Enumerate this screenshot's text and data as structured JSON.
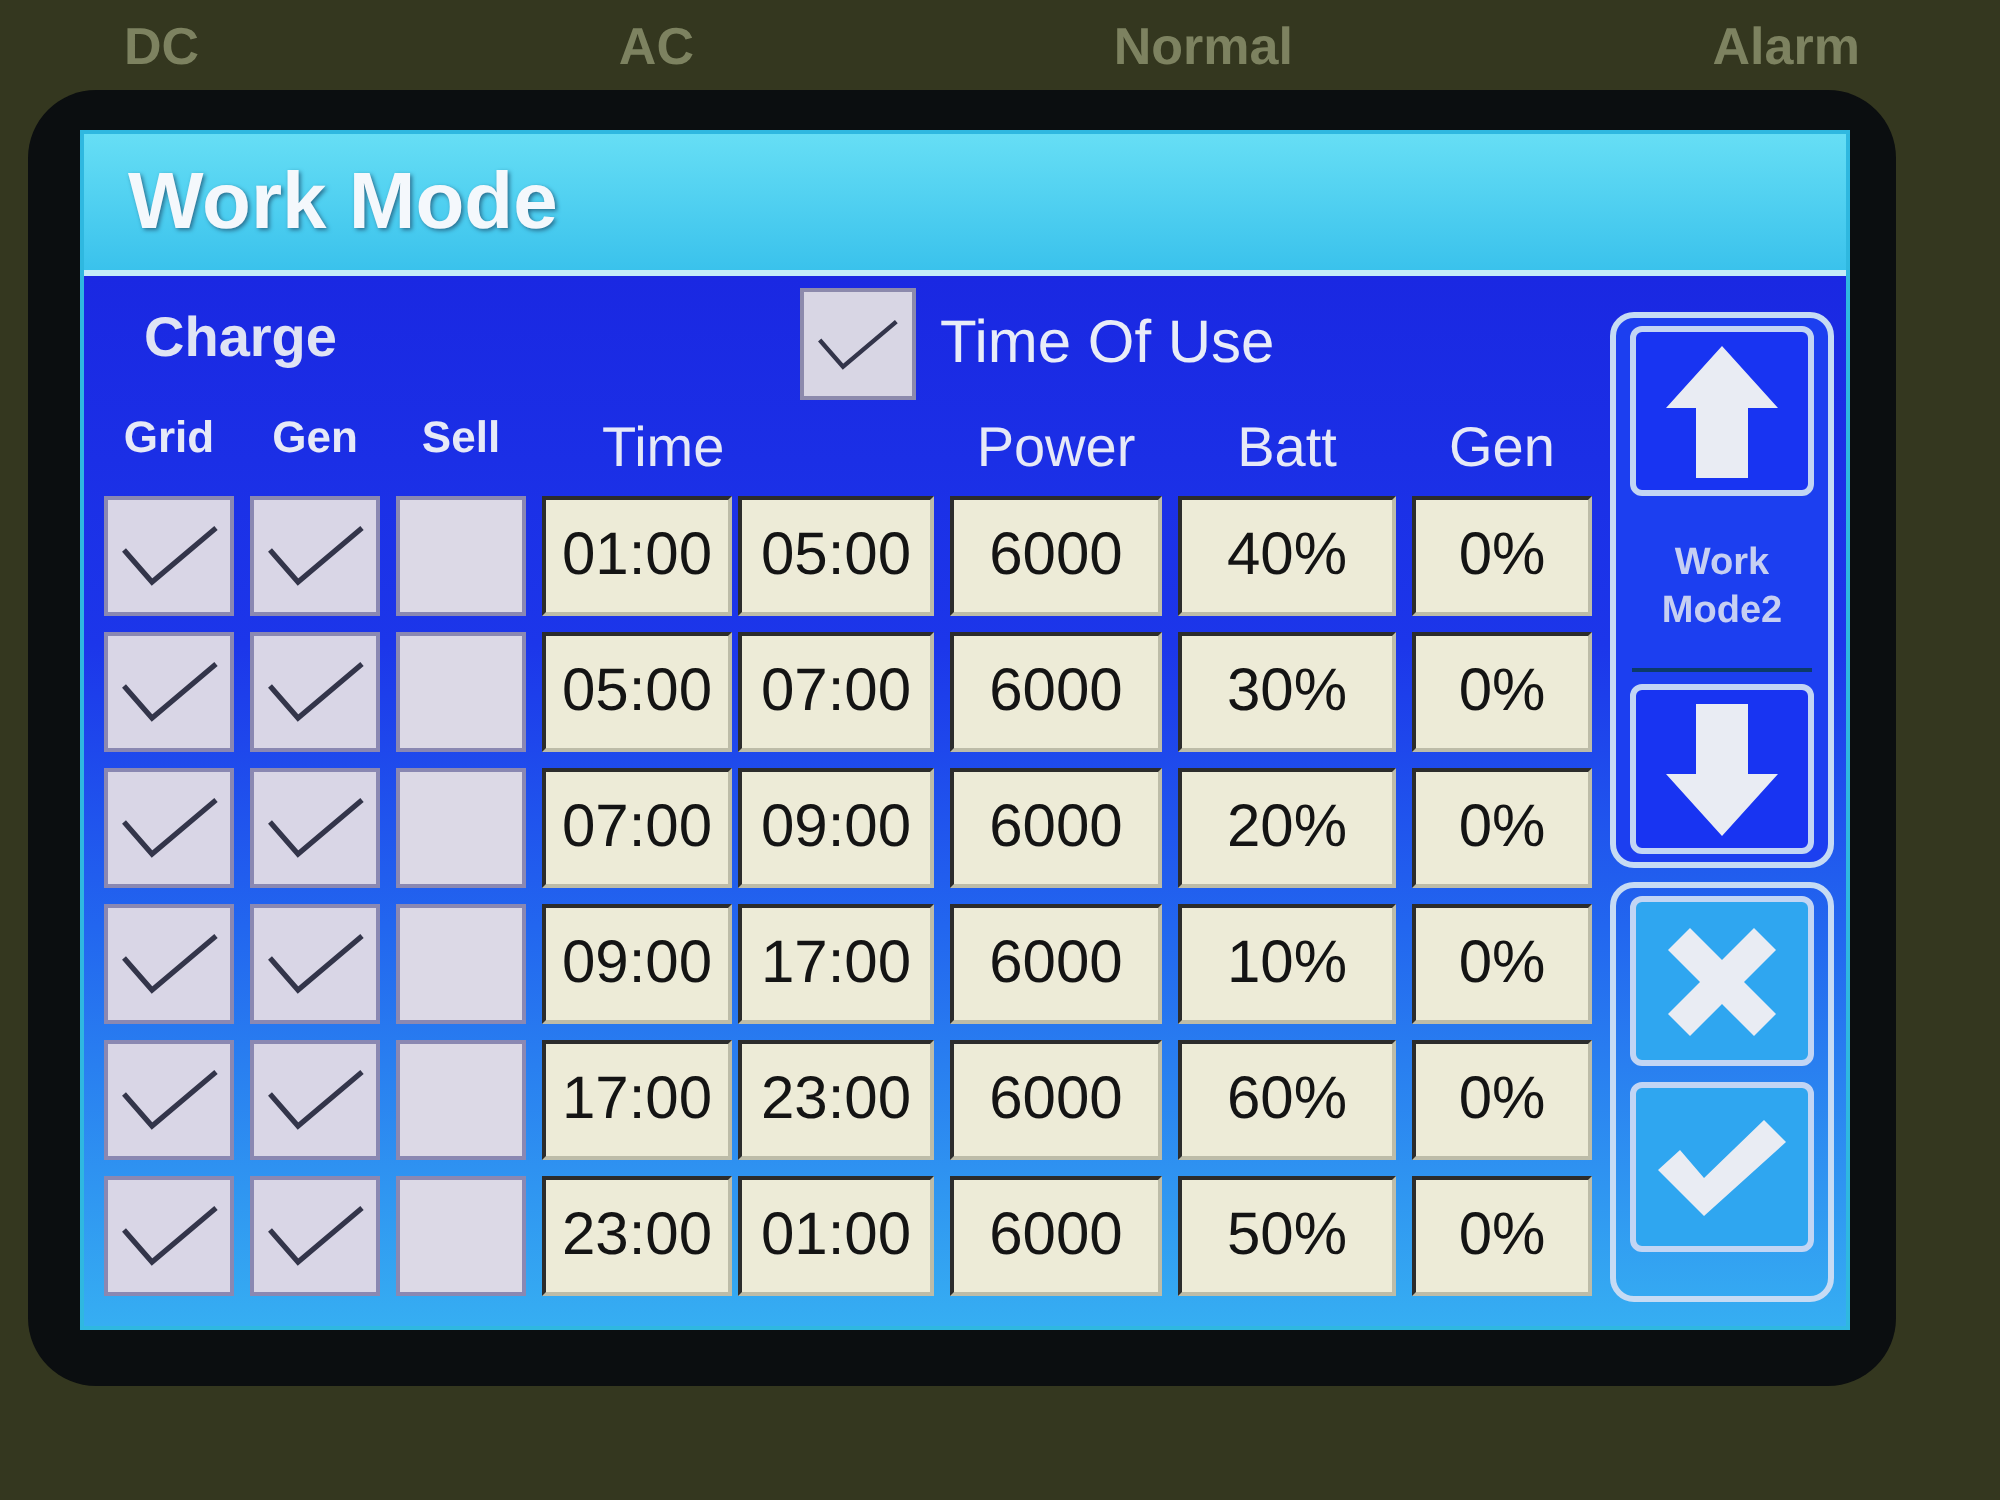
{
  "bezel_labels": [
    "DC",
    "AC",
    "Normal",
    "Alarm"
  ],
  "screen": {
    "title": "Work Mode",
    "charge_label": "Charge",
    "time_of_use": {
      "label": "Time Of Use",
      "checked": true
    },
    "columns": [
      {
        "label": "Grid",
        "kind": "check"
      },
      {
        "label": "Gen",
        "kind": "check"
      },
      {
        "label": "Sell",
        "kind": "check"
      },
      {
        "label": "Time",
        "kind": "time"
      },
      {
        "label": "Power",
        "kind": "value"
      },
      {
        "label": "Batt",
        "kind": "value"
      },
      {
        "label": "Gen",
        "kind": "value"
      }
    ],
    "rows": [
      {
        "grid": true,
        "gen": true,
        "sell": false,
        "start": "01:00",
        "end": "05:00",
        "power": "6000",
        "batt": "40%",
        "gen_value": "0%"
      },
      {
        "grid": true,
        "gen": true,
        "sell": false,
        "start": "05:00",
        "end": "07:00",
        "power": "6000",
        "batt": "30%",
        "gen_value": "0%"
      },
      {
        "grid": true,
        "gen": true,
        "sell": false,
        "start": "07:00",
        "end": "09:00",
        "power": "6000",
        "batt": "20%",
        "gen_value": "0%"
      },
      {
        "grid": true,
        "gen": true,
        "sell": false,
        "start": "09:00",
        "end": "17:00",
        "power": "6000",
        "batt": "10%",
        "gen_value": "0%"
      },
      {
        "grid": true,
        "gen": true,
        "sell": false,
        "start": "17:00",
        "end": "23:00",
        "power": "6000",
        "batt": "60%",
        "gen_value": "0%"
      },
      {
        "grid": true,
        "gen": true,
        "sell": false,
        "start": "23:00",
        "end": "01:00",
        "power": "6000",
        "batt": "50%",
        "gen_value": "0%"
      }
    ],
    "side_panel": {
      "mode_label": "Work Mode2"
    }
  }
}
